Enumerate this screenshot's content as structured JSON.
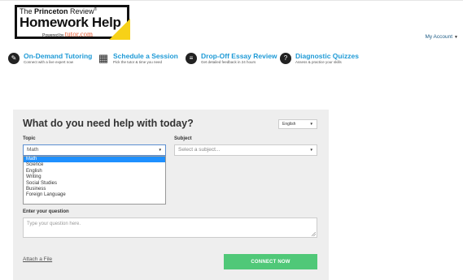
{
  "header": {
    "logo": {
      "line1_prefix": "The ",
      "line1_brand": "Princeton",
      "line1_suffix": " Review",
      "line2": "Homework Help",
      "line3_prefix": "Powered by ",
      "line3_brand": "tutor.com"
    },
    "account_label": "My Account"
  },
  "services": [
    {
      "title": "On-Demand Tutoring",
      "subtitle": "Connect with a live expert now",
      "icon": "tutor-icon"
    },
    {
      "title": "Schedule a Session",
      "subtitle": "Pick the tutor & time you need",
      "icon": "calendar-icon"
    },
    {
      "title": "Drop-Off Essay Review",
      "subtitle": "Get detailed feedback in 24 hours",
      "icon": "essay-icon"
    },
    {
      "title": "Diagnostic Quizzes",
      "subtitle": "Assess & practice your skills",
      "icon": "quiz-icon"
    }
  ],
  "form": {
    "title": "What do you need help with today?",
    "language": "English",
    "topic_label": "Topic",
    "topic_value": "Math",
    "topic_options": [
      "Math",
      "Science",
      "English",
      "Writing",
      "Social Studies",
      "Business",
      "Foreign Language"
    ],
    "subject_label": "Subject",
    "subject_value": "Select a subject...",
    "question_label": "Enter your question",
    "question_placeholder": "Type your question here.",
    "attach_label": "Attach a File",
    "connect_label": "CONNECT NOW"
  },
  "colors": {
    "accent_blue": "#1e9ad6",
    "connect_green": "#50c878",
    "logo_yellow": "#f7d117",
    "selected_option": "#1e90ff"
  }
}
